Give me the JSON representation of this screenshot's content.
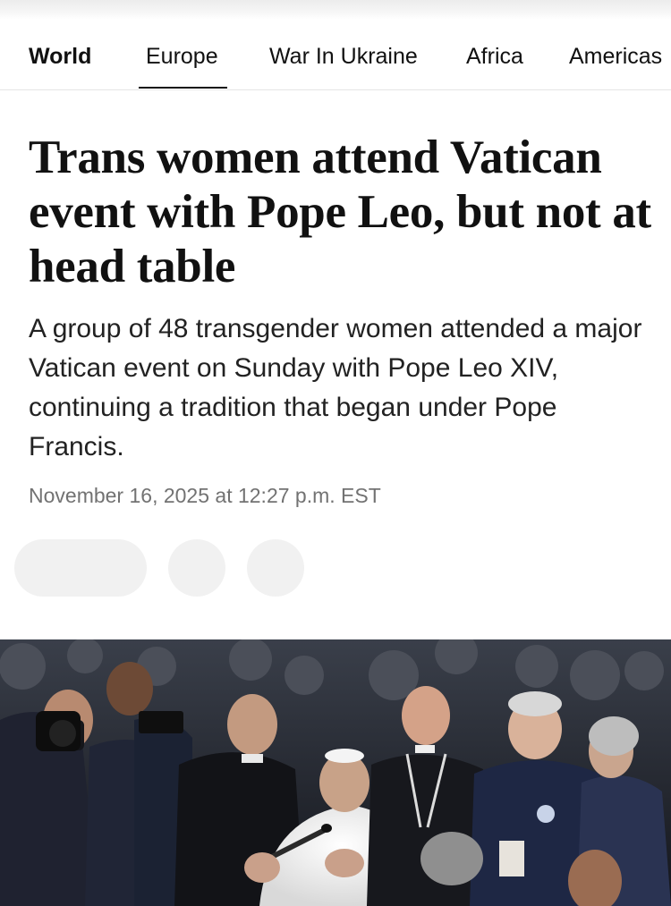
{
  "nav": {
    "items": [
      {
        "label": "World",
        "active": false
      },
      {
        "label": "Europe",
        "active": true
      },
      {
        "label": "War In Ukraine",
        "active": false
      },
      {
        "label": "Africa",
        "active": false
      },
      {
        "label": "Americas",
        "active": false
      }
    ]
  },
  "article": {
    "headline": "Trans women attend Vatican event with Pope Leo, but not at head table",
    "dek": "A group of 48 transgender women attended a major Vatican event on Sunday with Pope Leo XIV, continuing a tradition that began under Pope Francis.",
    "timestamp": "November 16, 2025 at 12:27 p.m. EST"
  },
  "actions": {
    "placeholders": [
      "share-pill",
      "action-circle",
      "action-circle"
    ]
  },
  "hero": {
    "subject": "Pope in white cassock speaking into microphone surrounded by crowd and priests"
  },
  "colors": {
    "text": "#111111",
    "muted": "#727272",
    "placeholder": "#f1f1f1",
    "divider": "#e5e5e5"
  }
}
